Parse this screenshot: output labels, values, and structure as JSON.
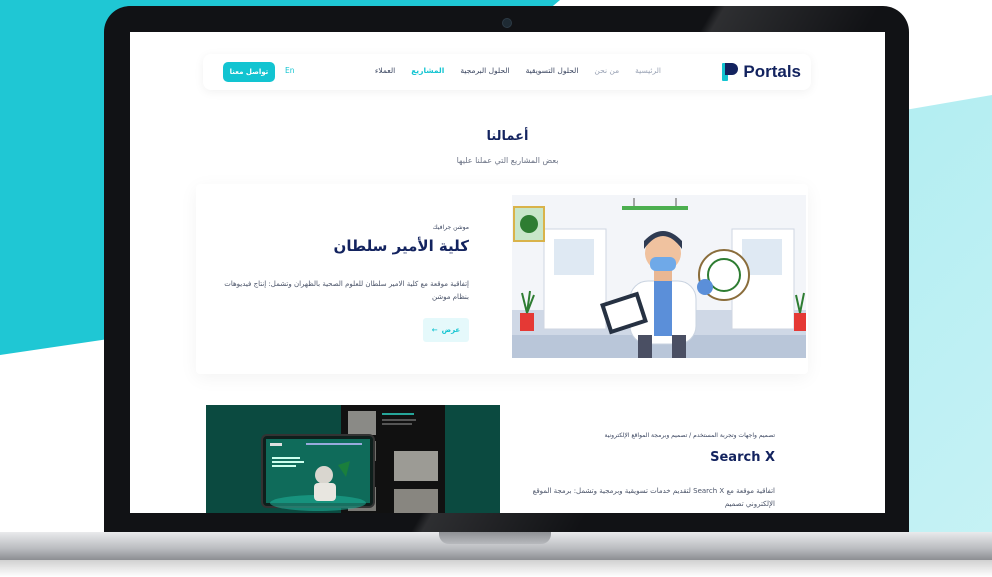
{
  "navbar": {
    "logo_text": "Portals",
    "links": [
      "الرئيسية",
      "من نحن",
      "الحلول التسويقية",
      "الحلول البرمجية",
      "المشاريع",
      "العملاء"
    ],
    "language": "En",
    "contact_button": "تواصل معنا"
  },
  "section": {
    "title": "أعمالنا",
    "subtitle": "بعض المشاريع التي عملنا عليها"
  },
  "projects": [
    {
      "category": "موشن جرافيك",
      "title": "كلية الأمير سلطان",
      "description": "إتفاقية موقعة مع كلية الامير سلطان للعلوم الصحية بالظهران وتشمل: إنتاج فيديوهات بنظام موشن",
      "view_label": "عرض",
      "arrow": "←"
    },
    {
      "category": "تصميم واجهات وتجربة المستخدم / تصميم وبرمجة المواقع الإلكترونية",
      "title": "Search X",
      "description": "اتفاقية موقعة مع Search X لتقديم خدمات تسويقية وبرمجية وتشمل: برمجة الموقع الإلكتروني تصميم"
    }
  ],
  "colors": {
    "brand_navy": "#13235f",
    "accent_cyan": "#12c4d1",
    "background_cyan": "#1fc7d4"
  }
}
